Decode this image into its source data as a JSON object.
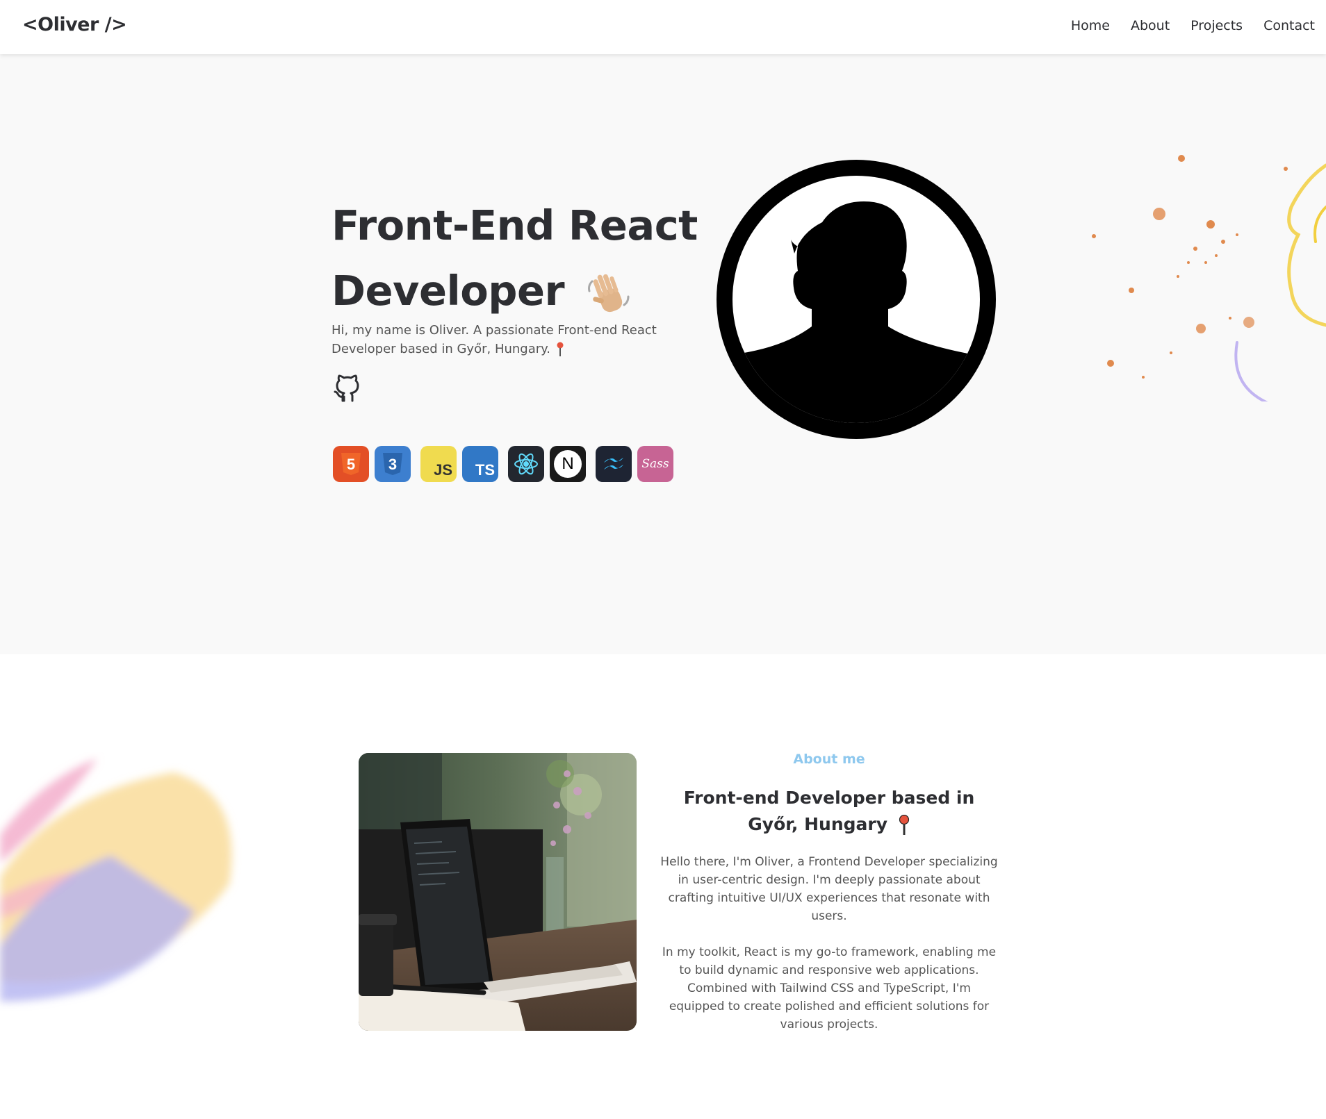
{
  "nav": {
    "logo": "<Oliver />",
    "links": [
      {
        "label": "Home"
      },
      {
        "label": "About"
      },
      {
        "label": "Projects"
      },
      {
        "label": "Contact"
      }
    ]
  },
  "hero": {
    "title_line1": "Front-End React",
    "title_line2": "Developer",
    "subtitle": "Hi, my name is Oliver. A passionate Front-end React Developer based in Győr, Hungary.",
    "github_icon": "github-icon",
    "tech_stack": [
      {
        "name": "html5-icon",
        "label": "5",
        "color": "#e34f26"
      },
      {
        "name": "css3-icon",
        "label": "3",
        "color": "#3d7fcf"
      },
      {
        "name": "javascript-icon",
        "label": "JS",
        "color": "#f0db4f"
      },
      {
        "name": "typescript-icon",
        "label": "TS",
        "color": "#3178c6"
      },
      {
        "name": "react-icon",
        "label": "",
        "color": "#23272f"
      },
      {
        "name": "nextjs-icon",
        "label": "N",
        "color": "#000000"
      },
      {
        "name": "tailwind-icon",
        "label": "",
        "color": "#1e2433"
      },
      {
        "name": "sass-icon",
        "label": "Sass",
        "color": "#c76494"
      }
    ]
  },
  "about": {
    "label": "About me",
    "title": "Front-end Developer based in Győr, Hungary",
    "paragraph1": "Hello there, I'm Oliver, a Frontend Developer specializing in user-centric design. I'm deeply passionate about crafting intuitive UI/UX experiences that resonate with users.",
    "paragraph2": "In my toolkit, React is my go-to framework, enabling me to build dynamic and responsive web applications. Combined with Tailwind CSS and TypeScript, I'm equipped to create polished and efficient solutions for various projects."
  },
  "colors": {
    "text": "#2d2e32",
    "accent": "#8ec8ee",
    "hero_bg": "#f9f9f9"
  }
}
